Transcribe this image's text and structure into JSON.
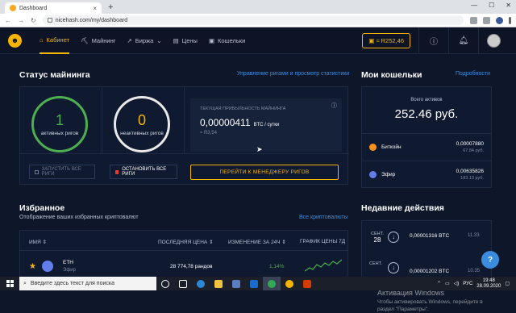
{
  "browser": {
    "tab_title": "Dashboard",
    "url": "nicehash.com/my/dashboard"
  },
  "nav": {
    "items": [
      {
        "label": "Кабинет",
        "icon": "home-icon"
      },
      {
        "label": "Майнинг",
        "icon": "pickaxe-icon"
      },
      {
        "label": "Биржа",
        "icon": "exchange-icon"
      },
      {
        "label": "Цены",
        "icon": "prices-icon"
      },
      {
        "label": "Кошельки",
        "icon": "wallet-icon"
      }
    ],
    "balance": "≈ R252,46"
  },
  "mining": {
    "title": "Статус майнинга",
    "manage_link": "Управление ригами и просмотр статистики",
    "active_count": "1",
    "active_label": "активных ригов",
    "inactive_count": "0",
    "inactive_label": "неактивных ригов",
    "profit_label": "ТЕКУЩАЯ ПРИБЫЛЬНОСТЬ МАЙНИНГА",
    "profit_value": "0,00000411",
    "profit_unit": "BTC / сутки",
    "profit_fiat": "≈ R3,54",
    "start_all": "ЗАПУСТИТЬ ВСЕ РИГИ",
    "stop_all": "ОСТАНОВИТЬ ВСЕ РИГИ",
    "go_manager": "ПЕРЕЙТИ К МЕНЕДЖЕРУ РИГОВ"
  },
  "wallets": {
    "title": "Мои кошельки",
    "details_link": "Подробности",
    "total_label": "Всего активов",
    "total_value": "252.46 руб.",
    "rows": [
      {
        "name": "Биткойн",
        "amount": "0,00007880",
        "fiat": "67.84 руб.",
        "color": "#f7931a"
      },
      {
        "name": "Эфир",
        "amount": "0,00635826",
        "fiat": "183.13 руб.",
        "color": "#627eea"
      }
    ]
  },
  "favorites": {
    "title": "Избранное",
    "subtitle": "Отображение ваших избранных криптовалют",
    "all_link": "Все криптовалюты",
    "columns": [
      "ИМЯ",
      "ПОСЛЕДНЯЯ ЦЕНА",
      "ИЗМЕНЕНИЕ ЗА 24Ч",
      "ГРАФИК ЦЕНЫ 7Д"
    ],
    "row": {
      "symbol": "ETH",
      "name": "Эфир",
      "price": "28 774,78 рандов",
      "change": "1,14%"
    }
  },
  "recent": {
    "title": "Недавние действия",
    "items": [
      {
        "month": "СЕНТ.",
        "day": "28",
        "amount": "0,00001316 BTC",
        "time": "11.33"
      },
      {
        "month": "СЕНТ.",
        "day": "",
        "amount": "0,00001202 BTC",
        "time": "10.35"
      }
    ]
  },
  "activation": {
    "title": "Активация Windows",
    "text": "Чтобы активировать Windows, перейдите в раздел \"Параметры\"."
  },
  "taskbar": {
    "search_placeholder": "Введите здесь текст для поиска",
    "lang": "РУС",
    "time": "19:48",
    "date": "28.09.2020"
  }
}
